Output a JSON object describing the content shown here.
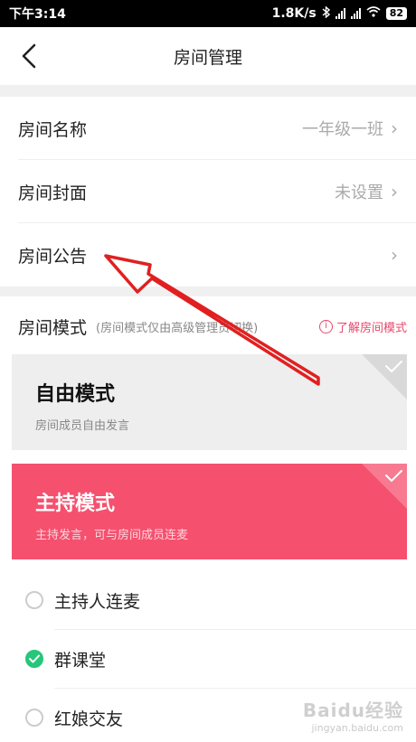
{
  "status": {
    "time": "下午3:14",
    "speed": "1.8K/s",
    "battery": "82"
  },
  "nav": {
    "title": "房间管理"
  },
  "rows": {
    "name": {
      "label": "房间名称",
      "value": "一年级一班"
    },
    "cover": {
      "label": "房间封面",
      "value": "未设置"
    },
    "notice": {
      "label": "房间公告"
    }
  },
  "mode": {
    "label": "房间模式",
    "hint": "(房间模式仅由高级管理员切换)",
    "link": "了解房间模式",
    "free": {
      "title": "自由模式",
      "desc": "房间成员自由发言",
      "selected": true
    },
    "host": {
      "title": "主持模式",
      "desc": "主持发言，可与房间成员连麦",
      "selected": true
    }
  },
  "options": [
    {
      "label": "主持人连麦",
      "checked": false
    },
    {
      "label": "群课堂",
      "checked": true
    },
    {
      "label": "红娘交友",
      "checked": false
    }
  ],
  "watermark": {
    "main": "Baidu经验",
    "sub": "jingyan.baidu.com"
  },
  "colors": {
    "accent": "#f5506e",
    "check": "#27c67a",
    "annotation": "#e02020"
  }
}
